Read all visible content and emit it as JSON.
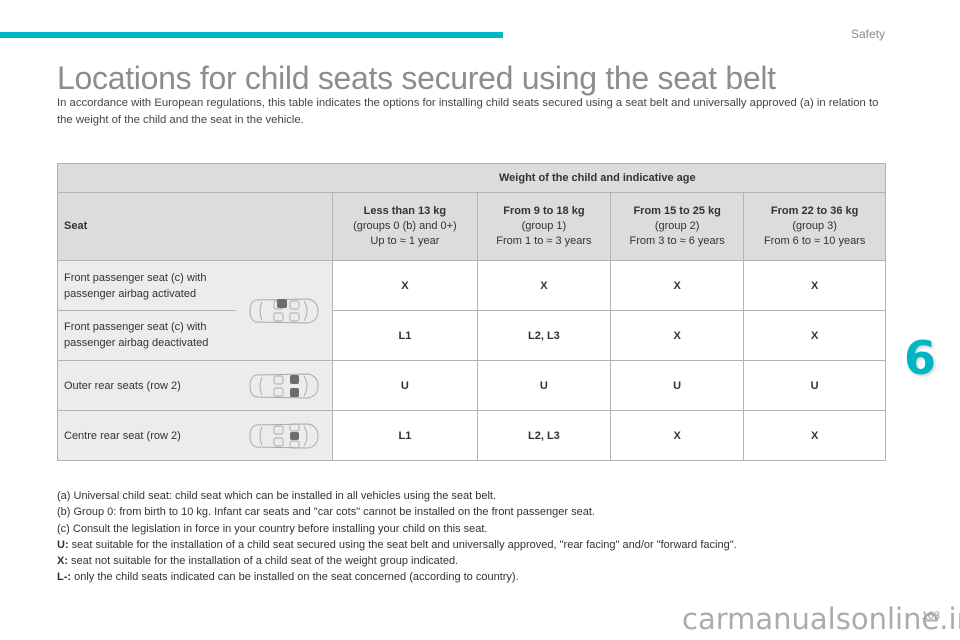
{
  "header": {
    "section": "Safety",
    "accent_color": "#00b5c4"
  },
  "title": "Locations for child seats secured using the seat belt",
  "intro": "In accordance with European regulations, this table indicates the options for installing child seats secured using a seat belt and universally approved (a) in relation to the weight of the child and the seat in the vehicle.",
  "table": {
    "weight_header": "Weight of the child and indicative age",
    "seat_header": "Seat",
    "groups": [
      {
        "title": "Less than 13 kg",
        "sub": "(groups 0 (b) and 0+)",
        "age": "Up to ≈ 1 year"
      },
      {
        "title": "From 9 to 18 kg",
        "sub": "(group 1)",
        "age": "From 1 to ≈ 3 years"
      },
      {
        "title": "From 15 to 25 kg",
        "sub": "(group 2)",
        "age": "From 3 to ≈ 6 years"
      },
      {
        "title": "From 22 to 36 kg",
        "sub": "(group 3)",
        "age": "From 6 to ≈ 10 years"
      }
    ],
    "rows": [
      {
        "seat": "Front passenger seat (c) with passenger airbag activated",
        "icon": "car-front-passenger-seat-icon",
        "values": [
          "X",
          "X",
          "X",
          "X"
        ]
      },
      {
        "seat": "Front passenger seat (c) with passenger airbag deactivated",
        "icon": "car-front-passenger-seat-icon",
        "values": [
          "L1",
          "L2, L3",
          "X",
          "X"
        ]
      },
      {
        "seat": "Outer rear seats (row 2)",
        "icon": "car-outer-rear-seats-icon",
        "values": [
          "U",
          "U",
          "U",
          "U"
        ]
      },
      {
        "seat": "Centre rear seat (row 2)",
        "icon": "car-centre-rear-seat-icon",
        "values": [
          "L1",
          "L2, L3",
          "X",
          "X"
        ]
      }
    ]
  },
  "notes": [
    {
      "key": "",
      "text": "(a) Universal child seat: child seat which can be installed in all vehicles using the seat belt."
    },
    {
      "key": "",
      "text": "(b) Group 0: from birth to 10 kg. Infant car seats and \"car cots\" cannot be installed on the front passenger seat."
    },
    {
      "key": "",
      "text": "(c) Consult the legislation in force in your country before installing your child on this seat."
    },
    {
      "key": "U:",
      "text": " seat suitable for the installation of a child seat secured using the seat belt and universally approved, \"rear facing\" and/or \"forward facing\"."
    },
    {
      "key": "X:",
      "text": " seat not suitable for the installation of a child seat of the weight group indicated."
    },
    {
      "key": "L-:",
      "text": " only the child seats indicated can be installed on the seat concerned (according to country)."
    }
  ],
  "chapter_number": "6",
  "page_number": "163",
  "watermark": "carmanualsonline.info"
}
